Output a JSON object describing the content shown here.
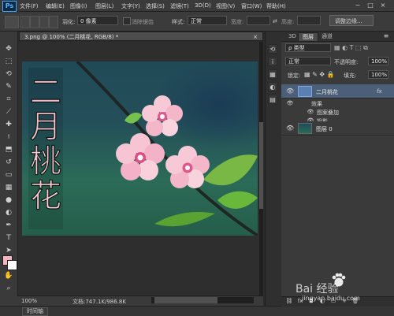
{
  "app": {
    "logo": "Ps",
    "menu": [
      "文件(F)",
      "编辑(E)",
      "图像(I)",
      "图层(L)",
      "文字(Y)",
      "选择(S)",
      "滤镜(T)",
      "3D(D)",
      "视图(V)",
      "窗口(W)",
      "帮助(H)"
    ],
    "window_controls": [
      "−",
      "□",
      "×"
    ]
  },
  "options_bar": {
    "feather_label": "羽化:",
    "feather_value": "0 像素",
    "antialias_label": "消除锯齿",
    "style_label": "样式:",
    "style_value": "正常",
    "width_label": "宽度:",
    "height_label": "高度:",
    "refine_edge_button": "调整边缘..."
  },
  "document": {
    "tab_title": "3.png @ 100% (二月桃花, RGB/8) *",
    "zoom": "100%",
    "doc_info": "文档:747.1K/986.8K",
    "canvas_text": "二月桃花"
  },
  "timeline": {
    "label": "时间轴"
  },
  "layers_panel": {
    "tabs": [
      "3D",
      "图层",
      "通道"
    ],
    "active_tab": "图层",
    "filter_kind": "ρ 类型",
    "blend_mode": "正常",
    "opacity_label": "不透明度:",
    "opacity_value": "100%",
    "lock_label": "锁定:",
    "fill_label": "填充:",
    "fill_value": "100%",
    "layers": [
      {
        "name": "二月桃花",
        "fx": "fx",
        "effects_label": "效果",
        "effects": [
          "图案叠加",
          "投影"
        ]
      },
      {
        "name": "图层 0"
      }
    ]
  },
  "watermark": {
    "text": "Bai 经验",
    "url": "jingyan.baidu.com"
  },
  "colors": {
    "foreground": "#f2b6c3",
    "background": "#ffffff",
    "accent_blue": "#46a6ff"
  }
}
